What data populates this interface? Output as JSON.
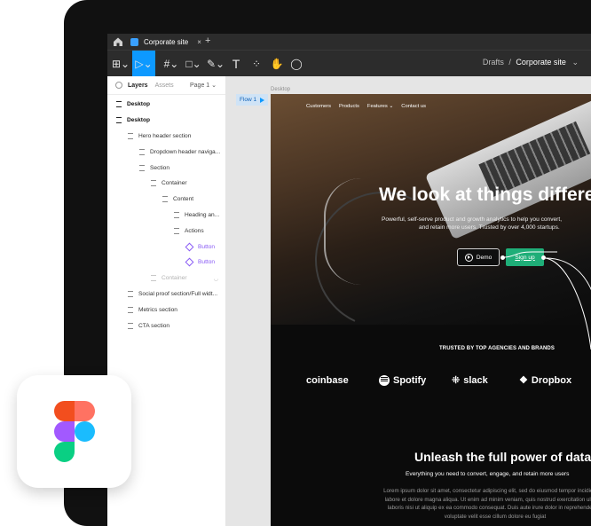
{
  "window": {
    "tab_title": "Corporate site",
    "tab_close": "×",
    "new_tab": "+"
  },
  "toolbar": {
    "breadcrumb_drafts": "Drafts",
    "breadcrumb_sep": "/",
    "breadcrumb_file": "Corporate site",
    "breadcrumb_chevron": "⌄",
    "tools": [
      {
        "icon": "main-menu-icon",
        "glyph": "⊞⌄"
      },
      {
        "icon": "move-tool-icon",
        "glyph": "▷⌄"
      },
      {
        "icon": "frame-tool-icon",
        "glyph": "#⌄"
      },
      {
        "icon": "shape-tool-icon",
        "glyph": "□⌄"
      },
      {
        "icon": "pen-tool-icon",
        "glyph": "✎⌄"
      },
      {
        "icon": "text-tool-icon",
        "glyph": "T"
      },
      {
        "icon": "resources-icon",
        "glyph": "⁘"
      },
      {
        "icon": "hand-tool-icon",
        "glyph": "✋"
      },
      {
        "icon": "comment-tool-icon",
        "glyph": "◯"
      }
    ]
  },
  "layers_panel": {
    "tab_layers": "Layers",
    "tab_assets": "Assets",
    "page": "Page 1 ⌄",
    "items": [
      {
        "label": "Desktop"
      },
      {
        "label": "Desktop"
      },
      {
        "label": "Hero header section"
      },
      {
        "label": "Dropdown header naviga..."
      },
      {
        "label": "Section"
      },
      {
        "label": "Container"
      },
      {
        "label": "Content"
      },
      {
        "label": "Heading an..."
      },
      {
        "label": "Actions"
      },
      {
        "label": "Button"
      },
      {
        "label": "Button"
      },
      {
        "label": "Container"
      },
      {
        "label": "Social proof section/Full widt..."
      },
      {
        "label": "Metrics section"
      },
      {
        "label": "CTA section"
      }
    ]
  },
  "canvas": {
    "flow_label": "Flow 1",
    "frame_label": "Desktop"
  },
  "site": {
    "nav": [
      "Customers",
      "Products",
      "Features ⌄",
      "Contact us"
    ],
    "headline": "We look at things differen",
    "sub_line1": "Powerful, self-serve product and growth analytics to help you convert,",
    "sub_line2": "and retain more users. Trusted by over 4,000 startups.",
    "demo_button": "Demo",
    "signup_button": "Sign up",
    "trusted": "TRUSTED BY TOP AGENCIES AND BRANDS",
    "logos": [
      "coinbase",
      "Spotify",
      "slack",
      "Dropbox"
    ],
    "section_title": "Unleash the full power of data",
    "section_sub": "Everything you need to convert, engage, and retain more users",
    "lorem": "Lorem ipsum dolor sit amet, consectetur adipiscing elit, sed do eiusmod tempor incididunt ut labore et dolore magna aliqua. Ut enim ad minim veniam, quis nostrud exercitation ullamco laboris nisi ut aliquip ex ea commodo consequat. Duis aute irure dolor in reprehenderit in voluptate velit esse cillum dolore eu fugiat"
  },
  "colors": {
    "accent": "#0d99ff",
    "button_green": "#1fae78",
    "component_purple": "#8a5cf5",
    "figma_red": "#f24e1e",
    "figma_orange": "#ff7262",
    "figma_purple": "#a259ff",
    "figma_blue": "#1abcfe",
    "figma_green": "#0acf83"
  }
}
